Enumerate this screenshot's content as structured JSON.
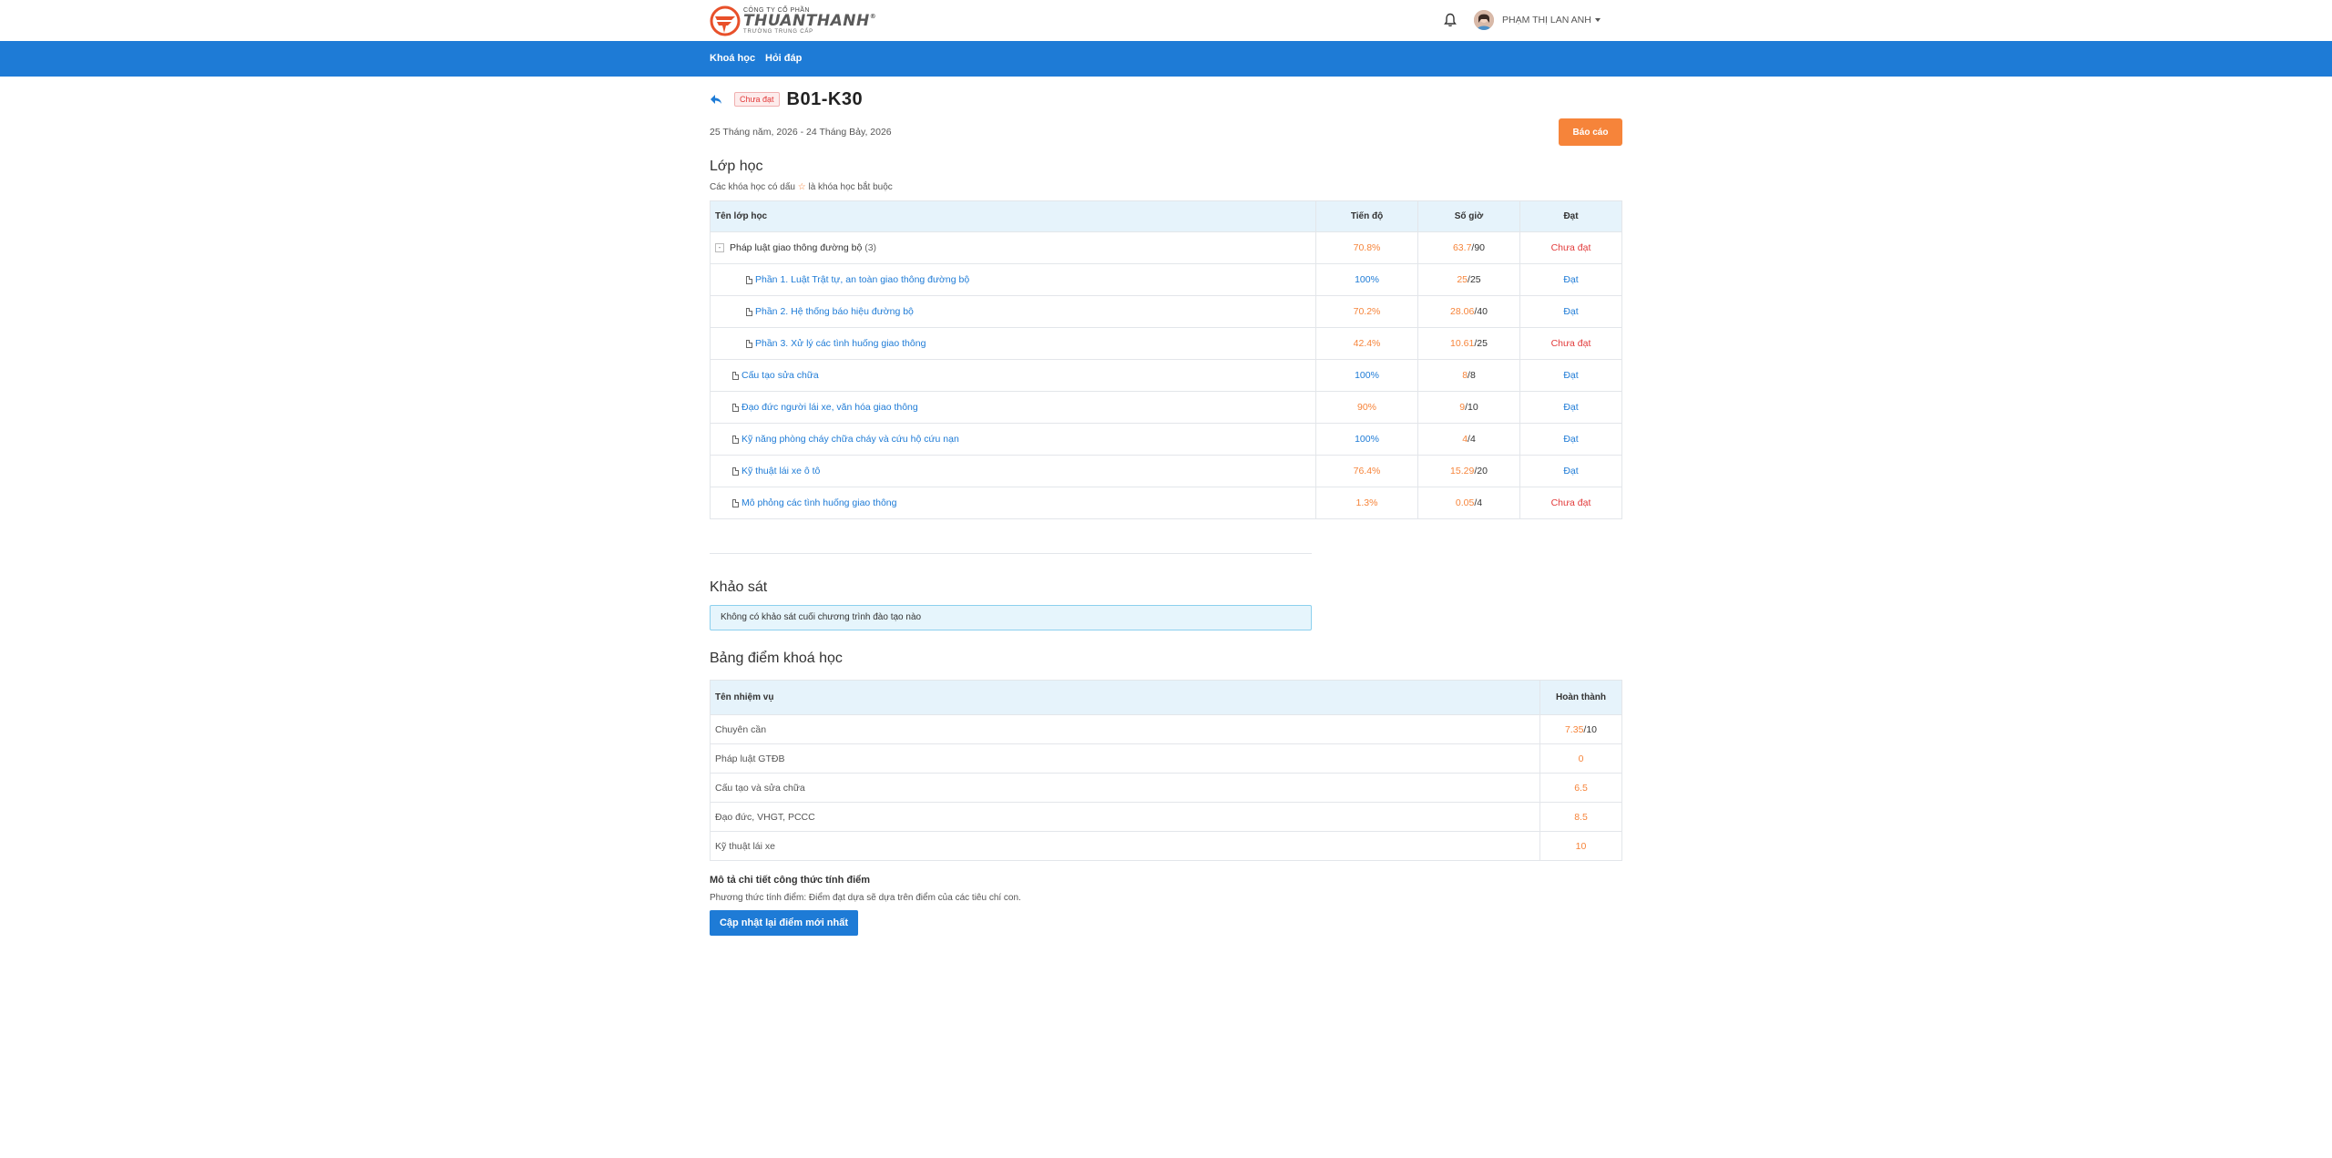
{
  "header": {
    "logo": {
      "company": "CÔNG TY CỔ PHẦN",
      "brand": "THUANTHANH",
      "sub": "TRƯỜNG TRUNG CẤP"
    },
    "bell_icon": "bell-icon",
    "user_name": "PHẠM THỊ LAN ANH"
  },
  "nav": {
    "items": [
      {
        "label": "Khoá học"
      },
      {
        "label": "Hỏi đáp"
      }
    ]
  },
  "course": {
    "status_badge": "Chưa đạt",
    "title": "B01-K30",
    "date_range": "25 Tháng năm, 2026 - 24 Tháng Bảy, 2026",
    "report_button": "Báo cáo"
  },
  "classes": {
    "heading": "Lớp học",
    "note_before": "Các khóa học có dấu",
    "note_star": "☆",
    "note_after": "là khóa học bắt buộc",
    "columns": {
      "name": "Tên lớp học",
      "progress": "Tiến độ",
      "hours": "Số giờ",
      "pass": "Đạt"
    },
    "group": {
      "name": "Pháp luật giao thông đường bộ",
      "count": "(3)",
      "toggle": "-",
      "progress": "70.8%",
      "hours_done": "63.7",
      "hours_total": "/90",
      "pass": "Chưa đạt"
    },
    "children": [
      {
        "name": "Phần 1. Luật Trật tự, an toàn giao thông đường bộ",
        "progress": "100%",
        "hours_done": "25",
        "hours_total": "/25",
        "pass": "Đạt"
      },
      {
        "name": "Phần 2. Hệ thống báo hiệu đường bộ",
        "progress": "70.2%",
        "hours_done": "28.06",
        "hours_total": "/40",
        "pass": "Đạt"
      },
      {
        "name": "Phần 3. Xử lý các tình huống giao thông",
        "progress": "42.4%",
        "hours_done": "10.61",
        "hours_total": "/25",
        "pass": "Chưa đạt"
      }
    ],
    "rows": [
      {
        "name": "Cấu tạo sửa chữa",
        "progress": "100%",
        "hours_done": "8",
        "hours_total": "/8",
        "pass": "Đạt"
      },
      {
        "name": "Đạo đức người lái xe, văn hóa giao thông",
        "progress": "90%",
        "hours_done": "9",
        "hours_total": "/10",
        "pass": "Đạt"
      },
      {
        "name": "Kỹ năng phòng cháy chữa cháy và cứu hộ cứu nạn",
        "progress": "100%",
        "hours_done": "4",
        "hours_total": "/4",
        "pass": "Đạt"
      },
      {
        "name": "Kỹ thuật lái xe ô tô",
        "progress": "76.4%",
        "hours_done": "15.29",
        "hours_total": "/20",
        "pass": "Đạt"
      },
      {
        "name": "Mô phỏng các tình huống giao thông",
        "progress": "1.3%",
        "hours_done": "0.05",
        "hours_total": "/4",
        "pass": "Chưa đạt"
      }
    ]
  },
  "survey": {
    "heading": "Khảo sát",
    "message": "Không có khảo sát cuối chương trình đào tạo nào"
  },
  "scores": {
    "heading": "Bảng điểm khoá học",
    "columns": {
      "task": "Tên nhiệm vụ",
      "done": "Hoàn thành"
    },
    "rows": [
      {
        "task": "Chuyên cần",
        "score": "7.35",
        "max": "/10"
      },
      {
        "task": "Pháp luật GTĐB",
        "score": "0",
        "max": ""
      },
      {
        "task": "Cấu tạo và sửa chữa",
        "score": "6.5",
        "max": ""
      },
      {
        "task": "Đạo đức, VHGT, PCCC",
        "score": "8.5",
        "max": ""
      },
      {
        "task": "Kỹ thuật lái xe",
        "score": "10",
        "max": ""
      }
    ],
    "formula_title": "Mô tả chi tiết công thức tính điểm",
    "formula_text": "Phương thức tính điểm: Điểm đạt dựa sẽ dựa trên điểm của các tiêu chí con.",
    "update_button": "Cập nhật lại điểm mới nhất"
  },
  "colors": {
    "primary": "#1e7bd6",
    "accent": "#f6843a",
    "danger": "#e23b3b",
    "table_header": "#e6f3fb"
  }
}
